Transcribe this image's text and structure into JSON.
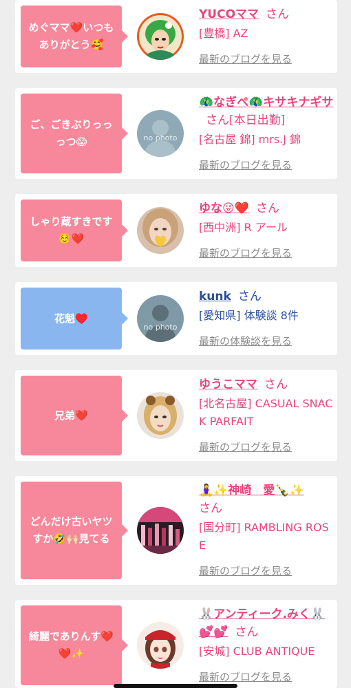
{
  "posts": [
    {
      "message": "めぐママ❤️いつもありがとう🥰",
      "name": "YUCOママ",
      "honorific": "さん",
      "detail": "[豊橋] AZ",
      "link": "最新のブログを見る",
      "avatar": "cartoon-woman-avatar"
    },
    {
      "message": "ご、ごきぶりっっっつ😱",
      "name": "🦚なぎぺ🦚キサキナギサ",
      "honorific": "さん[本日出勤]",
      "detail": "[名古屋 錦] mrs.J 錦",
      "link": "最新のブログを見る",
      "avatar": "no-photo-avatar"
    },
    {
      "message": "しゃり蔵すきです☺️❤️",
      "name": "ゆな😜❤️",
      "honorific": "さん",
      "detail": "[西中洲] R アール",
      "link": "最新のブログを見る",
      "avatar": "woman-photo-avatar"
    },
    {
      "message": "花魁♥️",
      "name": "kunk",
      "honorific": "さん",
      "detail": "[愛知県] 体験談 8件",
      "link": "最新の体験談を見る",
      "avatar": "no-photo-avatar"
    },
    {
      "message": "兄弟❤️",
      "name": "ゆうこママ",
      "honorific": "さん",
      "detail": "[北名古屋] CASUAL SNACK PARFAIT",
      "link": "最新のブログを見る",
      "avatar": "woman-photo-avatar"
    },
    {
      "message": "どんだけ古いヤツすか🤣🙌🏻見てる",
      "name": "🧘‍♀️✨神崎　愛🍾✨",
      "honorific": "さん",
      "detail": "[国分町] RAMBLING ROSE",
      "link": "最新のブログを見る",
      "avatar": "bar-photo-avatar"
    },
    {
      "message": "綺麗でありんす❤️❤️✨",
      "name": "🐰アンティーク.みく🐰💕💕",
      "honorific": "さん",
      "detail": "[安城] CLUB ANTIQUE",
      "link": "最新のブログを見る",
      "avatar": "anime-girl-avatar"
    }
  ],
  "colors": {
    "pink_bubble": "#f7879a",
    "blue_bubble": "#8ab6f0",
    "pink_text": "#e8457a",
    "blue_text": "#2b4fa0",
    "link_gray": "#8a8a8a",
    "background": "#eeeeee"
  },
  "avatar_caption": "no photo"
}
